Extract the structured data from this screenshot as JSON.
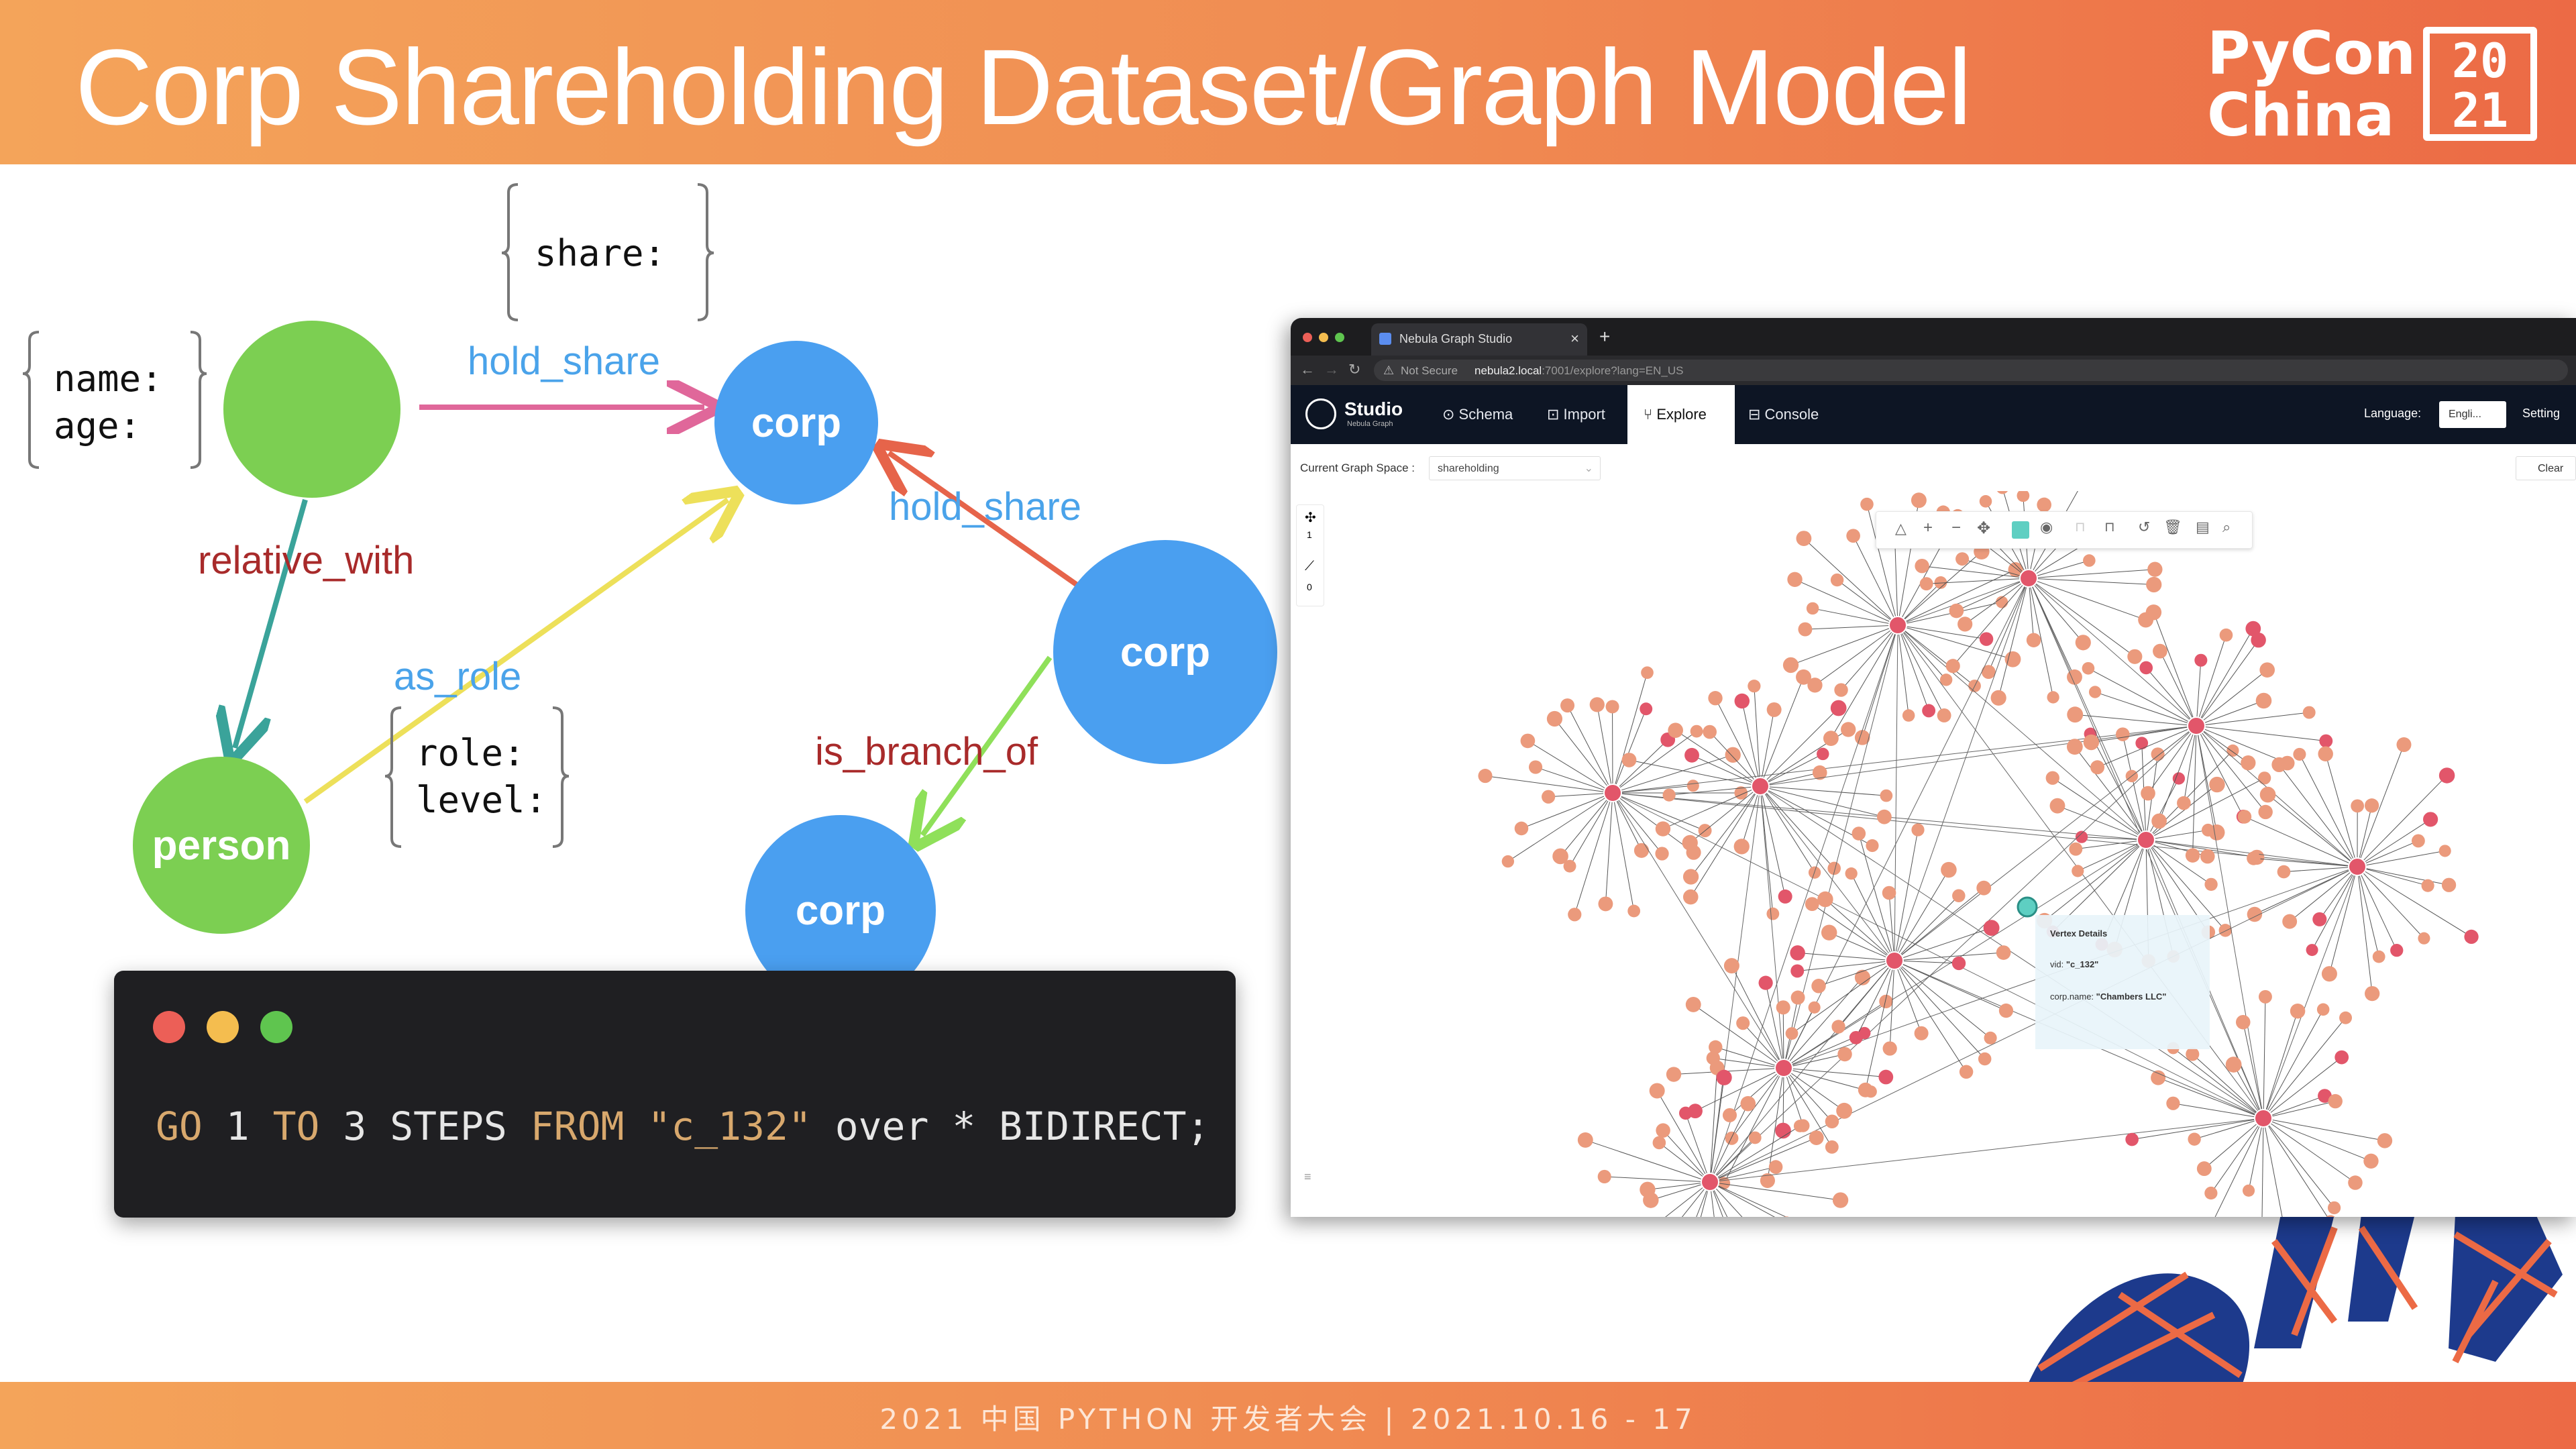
{
  "slide": {
    "title": "Corp Shareholding Dataset/Graph Model",
    "logo_line1": "PyCon",
    "logo_line2": "China",
    "logo_box_top": "20",
    "logo_box_bottom": "21",
    "footer": "2021 中国 PYTHON 开发者大会 | 2021.10.16 - 17"
  },
  "colors": {
    "accent_orange": "#f08b52",
    "person_green": "#7ccf52",
    "corp_blue": "#4a9ff0",
    "edge_pink": "#e0679a",
    "edge_red": "#e6644a",
    "edge_teal": "#3aa39a",
    "edge_yellow": "#ede05a",
    "edge_lightgreen": "#8fe05a",
    "label_blue": "#4aa3ea",
    "label_red": "#a82a2a"
  },
  "diagram": {
    "nodes": {
      "person_top": "person",
      "person_bottom": "person",
      "corp_top": "corp",
      "corp_right": "corp",
      "corp_bottom": "corp"
    },
    "edges": {
      "hold_share_1": "hold_share",
      "hold_share_2": "hold_share",
      "relative_with": "relative_with",
      "as_role": "as_role",
      "is_branch_of": "is_branch_of"
    },
    "props": {
      "person": "name:\nage:",
      "share": "share:",
      "role": "role:\nlevel:"
    }
  },
  "code": {
    "kw_go": "GO",
    "n1": "1",
    "kw_to": "TO",
    "n3": "3",
    "steps": "STEPS",
    "kw_from": "FROM",
    "vid": "\"c_132\"",
    "over": "over",
    "star": "*",
    "bidirect": "BIDIRECT;"
  },
  "studio": {
    "tab_title": "Nebula Graph Studio",
    "tab_close": "×",
    "tab_add": "+",
    "not_secure": "Not Secure",
    "url_host": "nebula2.local",
    "url_rest": ":7001/explore?lang=EN_US",
    "brand": "Studio",
    "brand_sub": "Nebula Graph",
    "nav": [
      "Schema",
      "Import",
      "Explore",
      "Console"
    ],
    "language_label": "Language:",
    "language_value": "Engli...",
    "setting": "Setting",
    "graph_space_label": "Current Graph Space :",
    "graph_space_value": "shareholding",
    "clear": "Clear",
    "side_counts": [
      "1",
      "0"
    ],
    "vertex_details": {
      "title": "Vertex Details",
      "vid_label": "vid:",
      "vid_value": "\"c_132\"",
      "name_label": "corp.name:",
      "name_value": "\"Chambers LLC\""
    }
  }
}
